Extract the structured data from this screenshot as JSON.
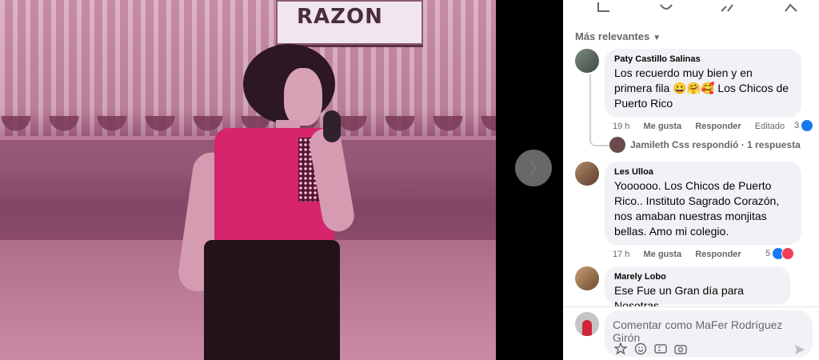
{
  "photo": {
    "sign_text": "RAZON"
  },
  "sort_label": "Más relevantes",
  "comments": [
    {
      "author": "Paty Castillo Salinas",
      "text": "Los recuerdo muy bien y en primera fila 😀🤗🥰 Los Chicos de Puerto Rico",
      "time": "19 h",
      "like": "Me gusta",
      "reply": "Responder",
      "edited": "Editado",
      "reactions": "3"
    },
    {
      "author": "Les Ulloa",
      "text": "Yoooooo. Los Chicos de Puerto Rico.. Instituto Sagrado Corazón, nos amaban nuestras monjitas bellas. Amo mi colegio.",
      "time": "17 h",
      "like": "Me gusta",
      "reply": "Responder",
      "reactions": "5"
    },
    {
      "author": "Marely Lobo",
      "text": "Ese Fue un Gran día para Nosotras,"
    }
  ],
  "replies_link": "Jamileth Css respondió · 1 respuesta",
  "compose": {
    "placeholder": "Comentar como MaFer Rodríguez Girón"
  },
  "colors": {
    "like": "#1877f2",
    "love": "#f33e58",
    "bubble": "#f0f2f5"
  },
  "icons": [
    "bookmark-icon",
    "comment-icon",
    "share-icon",
    "send-icon",
    "sticker-icon",
    "emoji-icon",
    "gif-icon",
    "camera-icon",
    "chevron-right-icon"
  ]
}
